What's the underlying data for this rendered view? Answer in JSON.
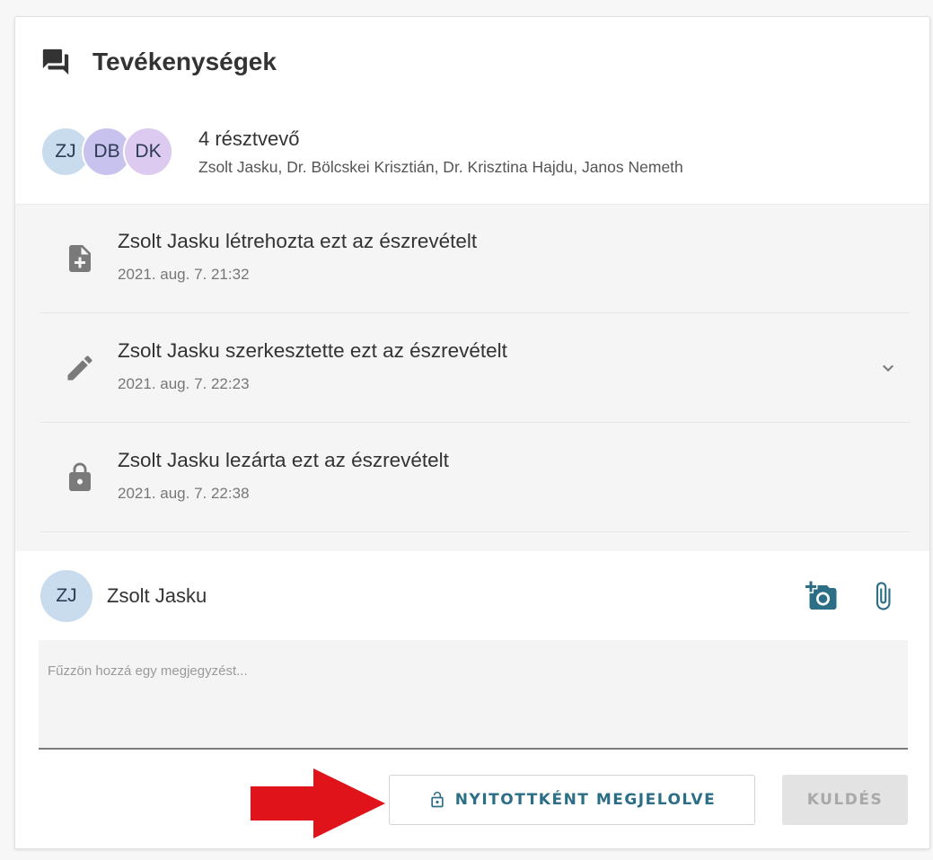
{
  "panel": {
    "title": "Tevékenységek"
  },
  "participants": {
    "avatars": [
      {
        "initials": "ZJ",
        "color": "#c9dcee"
      },
      {
        "initials": "DB",
        "color": "#c8c3ee"
      },
      {
        "initials": "DK",
        "color": "#dccaf0"
      }
    ],
    "count_label": "4 résztvevő",
    "names": "Zsolt Jasku, Dr. Bölcskei Krisztián, Dr. Krisztina Hajdu, Janos Nemeth"
  },
  "activities": [
    {
      "icon": "note-add-icon",
      "text": "Zsolt Jasku létrehozta ezt az észrevételt",
      "time": "2021. aug. 7. 21:32",
      "expandable": false
    },
    {
      "icon": "pencil-icon",
      "text": "Zsolt Jasku szerkesztette ezt az észrevételt",
      "time": "2021. aug. 7. 22:23",
      "expandable": true
    },
    {
      "icon": "lock-icon",
      "text": "Zsolt Jasku lezárta ezt az észrevételt",
      "time": "2021. aug. 7. 22:38",
      "expandable": false
    }
  ],
  "composer": {
    "user_initials": "ZJ",
    "user_name": "Zsolt Jasku",
    "placeholder": "Fűzzön hozzá egy megjegyzést...",
    "value": "",
    "tools": [
      "add-photo-icon",
      "attachment-icon"
    ]
  },
  "actions": {
    "open_label": "NYITOTTKÉNT MEGJELOLVE",
    "send_label": "KULDÉS"
  },
  "colors": {
    "accent": "#2b6e86",
    "arrow": "#e0121a",
    "icon_gray": "#7a7a7a"
  }
}
